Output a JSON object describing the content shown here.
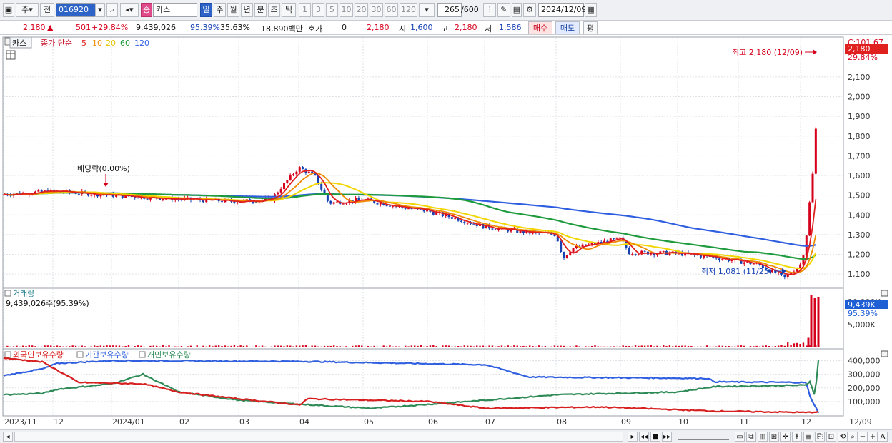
{
  "toolbar": {
    "market": "주",
    "prev_label": "전",
    "code": "016920",
    "name_badge": "종",
    "name": "카스",
    "periods": [
      "일",
      "주",
      "월",
      "년",
      "분",
      "초",
      "틱"
    ],
    "intervals": [
      "1",
      "3",
      "5",
      "10",
      "20",
      "30",
      "60",
      "120"
    ],
    "count": "265",
    "count_max": "/600",
    "date": "2024/12/09"
  },
  "info": {
    "price": "2,180",
    "change": "501",
    "change_pct": "+29.84%",
    "volume": "9,439,026",
    "vol_ratio": "95.39%",
    "turnover": "35.63%",
    "amount": "18,890백만",
    "quote_label": "호가",
    "quote": "0",
    "quote_price": "2,180",
    "open_label": "시",
    "open": "1,600",
    "high_label": "고",
    "high": "2,180",
    "low_label": "저",
    "low": "1,586",
    "buy_label": "매수",
    "sell_label": "매도",
    "eval_label": "평"
  },
  "price_panel": {
    "tab": "카스",
    "legend_prefix": "종가 단순",
    "ma": [
      {
        "period": "5",
        "color": "#e01f1f"
      },
      {
        "period": "10",
        "color": "#f08a00"
      },
      {
        "period": "20",
        "color": "#f2d600"
      },
      {
        "period": "60",
        "color": "#1e9b3c"
      },
      {
        "period": "120",
        "color": "#2f5fe0"
      }
    ],
    "dividend_note": "배당락(0.00%)",
    "high_note": "최고 2,180 (12/09)",
    "low_note": "최저 1,081 (11/25)",
    "axis_top": "C:101.67",
    "last_price_tag": "2,180",
    "last_pct_tag": "29.84%",
    "ticks": [
      "2,100",
      "2,000",
      "1,900",
      "1,800",
      "1,700",
      "1,600",
      "1,500",
      "1,400",
      "1,300",
      "1,200",
      "1,100"
    ]
  },
  "volume_panel": {
    "title": "거래량",
    "value_text": "9,439,026주(95.39%)",
    "axis_top": "10,000K",
    "tag_value": "9,439K",
    "tag_pct": "95.39%",
    "ticks": [
      "5,000K"
    ]
  },
  "holdings_panel": {
    "series": [
      {
        "name": "외국인보유수량",
        "color": "#d81f1f"
      },
      {
        "name": "기관보유수량",
        "color": "#2f5fe0"
      },
      {
        "name": "개인보유수량",
        "color": "#2e8b57"
      }
    ],
    "ticks": [
      "400,000",
      "300,000",
      "200,000",
      "100,000"
    ]
  },
  "x_axis": {
    "labels": [
      "2023/11",
      "12",
      "2024/01",
      "02",
      "03",
      "04",
      "05",
      "06",
      "07",
      "08",
      "09",
      "10",
      "11",
      "12"
    ],
    "end_label": "12/09"
  },
  "colors": {
    "up": "#d6001c",
    "down": "#1642b4",
    "grid": "#d8dbe0",
    "tag": "#e01f1f"
  },
  "chart_data": {
    "type": "candlestick",
    "xlabels": [
      "2023/11",
      "12",
      "2024/01",
      "02",
      "03",
      "04",
      "05",
      "06",
      "07",
      "08",
      "09",
      "10",
      "11",
      "12"
    ],
    "price_keypoints": [
      [
        "2023/11",
        1510
      ],
      [
        "12",
        1520
      ],
      [
        "2024/01",
        1495
      ],
      [
        "02",
        1480
      ],
      [
        "03",
        1470
      ],
      [
        "03",
        1500
      ],
      [
        "04",
        1640
      ],
      [
        "04",
        1600
      ],
      [
        "04",
        1460
      ],
      [
        "05",
        1480
      ],
      [
        "06",
        1420
      ],
      [
        "07",
        1340
      ],
      [
        "08",
        1300
      ],
      [
        "08",
        1180
      ],
      [
        "08",
        1240
      ],
      [
        "09",
        1280
      ],
      [
        "09",
        1200
      ],
      [
        "10",
        1210
      ],
      [
        "11",
        1160
      ],
      [
        "11",
        1081
      ],
      [
        "12",
        1150
      ],
      [
        "12",
        1600
      ],
      [
        "12",
        2180
      ]
    ],
    "ma60_keypoints": [
      [
        1495
      ],
      [
        1500
      ],
      [
        1495
      ],
      [
        1490
      ],
      [
        1480
      ],
      [
        1470
      ],
      [
        1450
      ],
      [
        1410
      ],
      [
        1360
      ],
      [
        1320
      ],
      [
        1280
      ],
      [
        1240
      ],
      [
        1215
      ],
      [
        1200
      ],
      [
        1180
      ],
      [
        1200
      ]
    ],
    "ma120_keypoints": [
      [
        1525
      ],
      [
        1515
      ],
      [
        1505
      ],
      [
        1500
      ],
      [
        1500
      ],
      [
        1505
      ],
      [
        1505
      ],
      [
        1495
      ],
      [
        1475
      ],
      [
        1440
      ],
      [
        1400
      ],
      [
        1360
      ],
      [
        1320
      ],
      [
        1280
      ],
      [
        1245
      ],
      [
        1245
      ]
    ],
    "ylim": [
      1050,
      2230
    ],
    "volume_last_days": [
      180,
      9800,
      9200,
      9439
    ],
    "holdings_ylim": [
      0,
      450000
    ]
  }
}
